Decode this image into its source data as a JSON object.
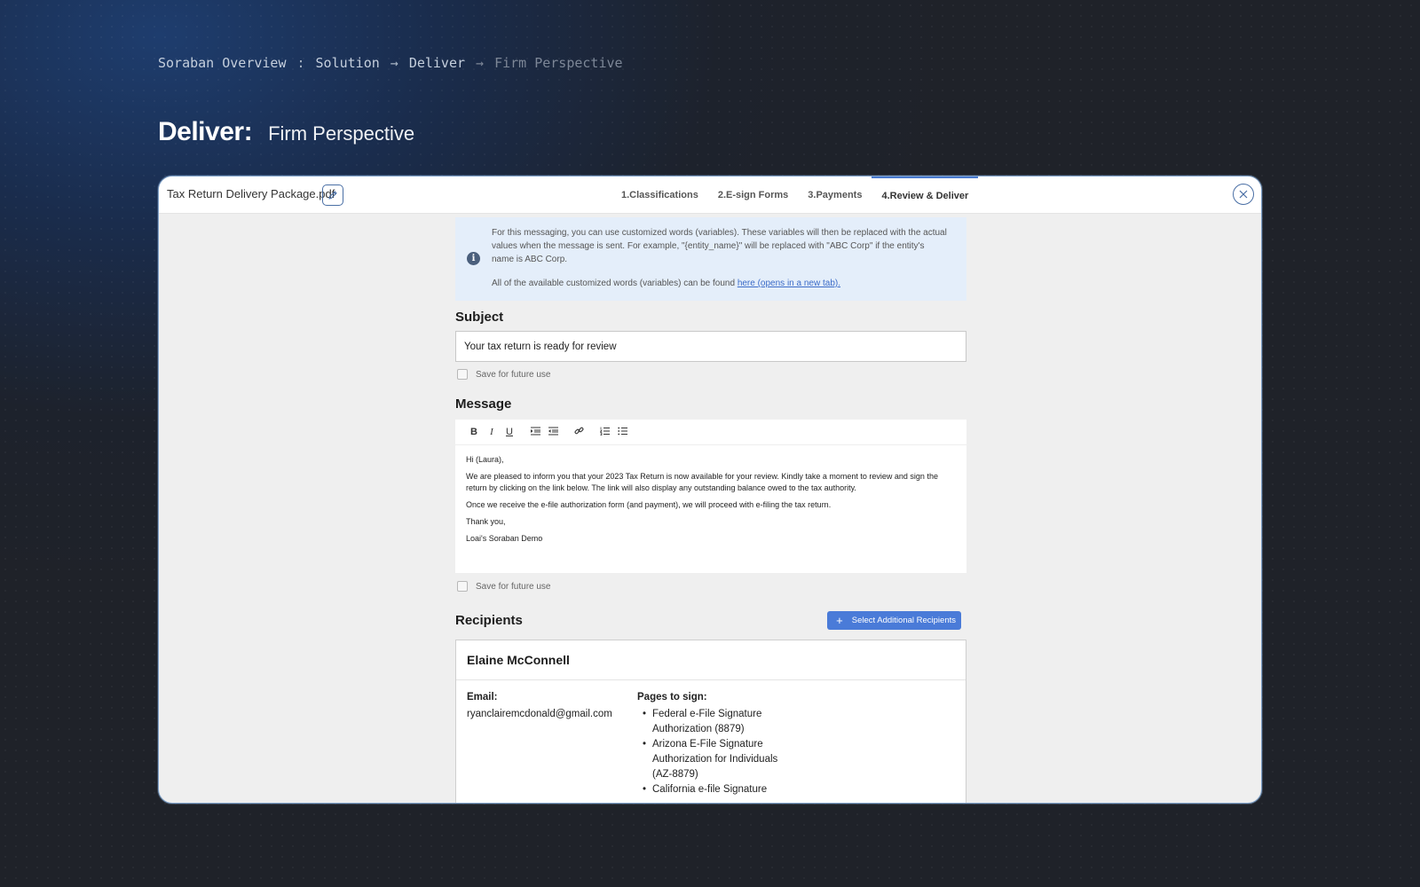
{
  "breadcrumb": {
    "root": "Soraban Overview",
    "sep1": ":",
    "solution": "Solution",
    "arrow1": "→",
    "deliver": "Deliver",
    "arrow2": "→",
    "current": "Firm Perspective"
  },
  "heading": {
    "bold": "Deliver:",
    "light": "Firm Perspective"
  },
  "window": {
    "filename": "Tax Return Delivery Package.pdf",
    "tabs": [
      {
        "label": "1.Classifications"
      },
      {
        "label": "2.E-sign Forms"
      },
      {
        "label": "3.Payments"
      },
      {
        "label": "4.Review & Deliver"
      }
    ]
  },
  "info": {
    "text1": "For this messaging, you can use customized words (variables). These variables will then be replaced with the actual values when the message is sent. For example, \"{entity_name}\" will be replaced with \"ABC Corp\" if the entity's name is ABC Corp.",
    "text2": "All of the available customized words (variables) can be found ",
    "link": "here (opens in a new tab)."
  },
  "subject": {
    "title": "Subject",
    "value": "Your tax return is ready for review",
    "save_label": "Save for future use"
  },
  "message": {
    "title": "Message",
    "toolbar": {
      "bold": "B",
      "italic": "I",
      "underline": "U"
    },
    "lines": [
      "Hi (Laura),",
      "We are pleased to inform you that your 2023 Tax Return is now available for your review. Kindly take a moment to review and sign the return by clicking on the link below. The link will also display any outstanding balance owed to the tax authority.",
      "Once we receive the e-file authorization form (and payment), we will proceed with e-filing the tax return.",
      "Thank you,",
      "Loai's Soraban Demo"
    ],
    "save_label": "Save for future use"
  },
  "recipients": {
    "title": "Recipients",
    "add_button": "Select Additional Recipients",
    "card": {
      "name": "Elaine McConnell",
      "email_label": "Email:",
      "email": "ryanclairemcdonald@gmail.com",
      "pages_label": "Pages to sign:",
      "pages": [
        "Federal e-File Signature Authorization (8879)",
        "Arizona E-File Signature Authorization for Individuals (AZ-8879)",
        "California e-file Signature"
      ]
    }
  },
  "colors": {
    "accent": "#4a7bd8",
    "info_bg": "#e4eefa",
    "link": "#3c6cc8"
  }
}
